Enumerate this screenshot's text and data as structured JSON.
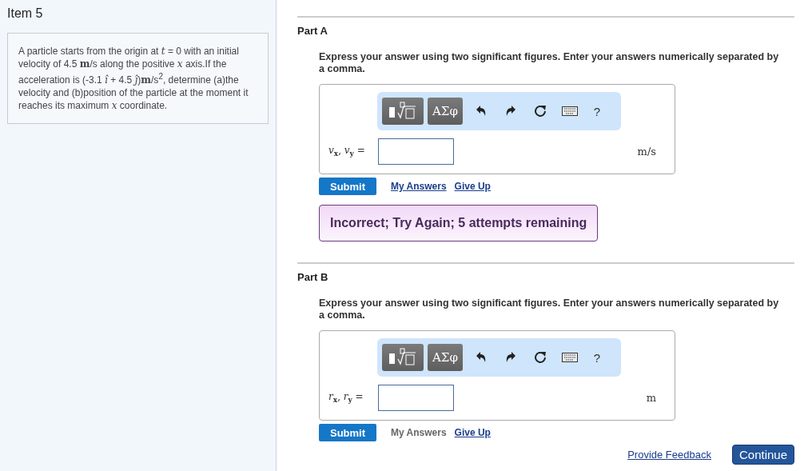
{
  "item": {
    "title": "Item 5",
    "problem": "A particle starts from the origin at *t* = 0 with an initial velocity of 4.5 **m**/s along the positive *x* axis.If the acceleration is (-3.1 *î* + 4.5 *ĵ*)**m**/s$^{2}$, determine (a)the velocity and (b)position of the particle at the moment it reaches its maximum *x* coordinate."
  },
  "parts": [
    {
      "title": "Part A",
      "instructions": "Express your answer using two significant figures. Enter your answers numerically separated by a comma.",
      "toolbar": [
        "ΑΣφ",
        "?"
      ],
      "label": "*v*$_{x}$, *v*$_{y}$ =",
      "unit": "m/s",
      "submit": "Submit",
      "my_answers": {
        "label": "My Answers",
        "disabled": false
      },
      "give_up": "Give Up",
      "feedback": "Incorrect; Try Again; 5 attempts remaining"
    },
    {
      "title": "Part B",
      "instructions": "Express your answer using two significant figures. Enter your answers numerically separated by a comma.",
      "toolbar": [
        "ΑΣφ",
        "?"
      ],
      "label": "*r*$_{x}$, *r*$_{y}$ =",
      "unit": "m",
      "submit": "Submit",
      "my_answers": {
        "label": "My Answers",
        "disabled": true
      },
      "give_up": "Give Up"
    }
  ],
  "footer": {
    "feedback_link": "Provide Feedback",
    "continue": "Continue"
  }
}
